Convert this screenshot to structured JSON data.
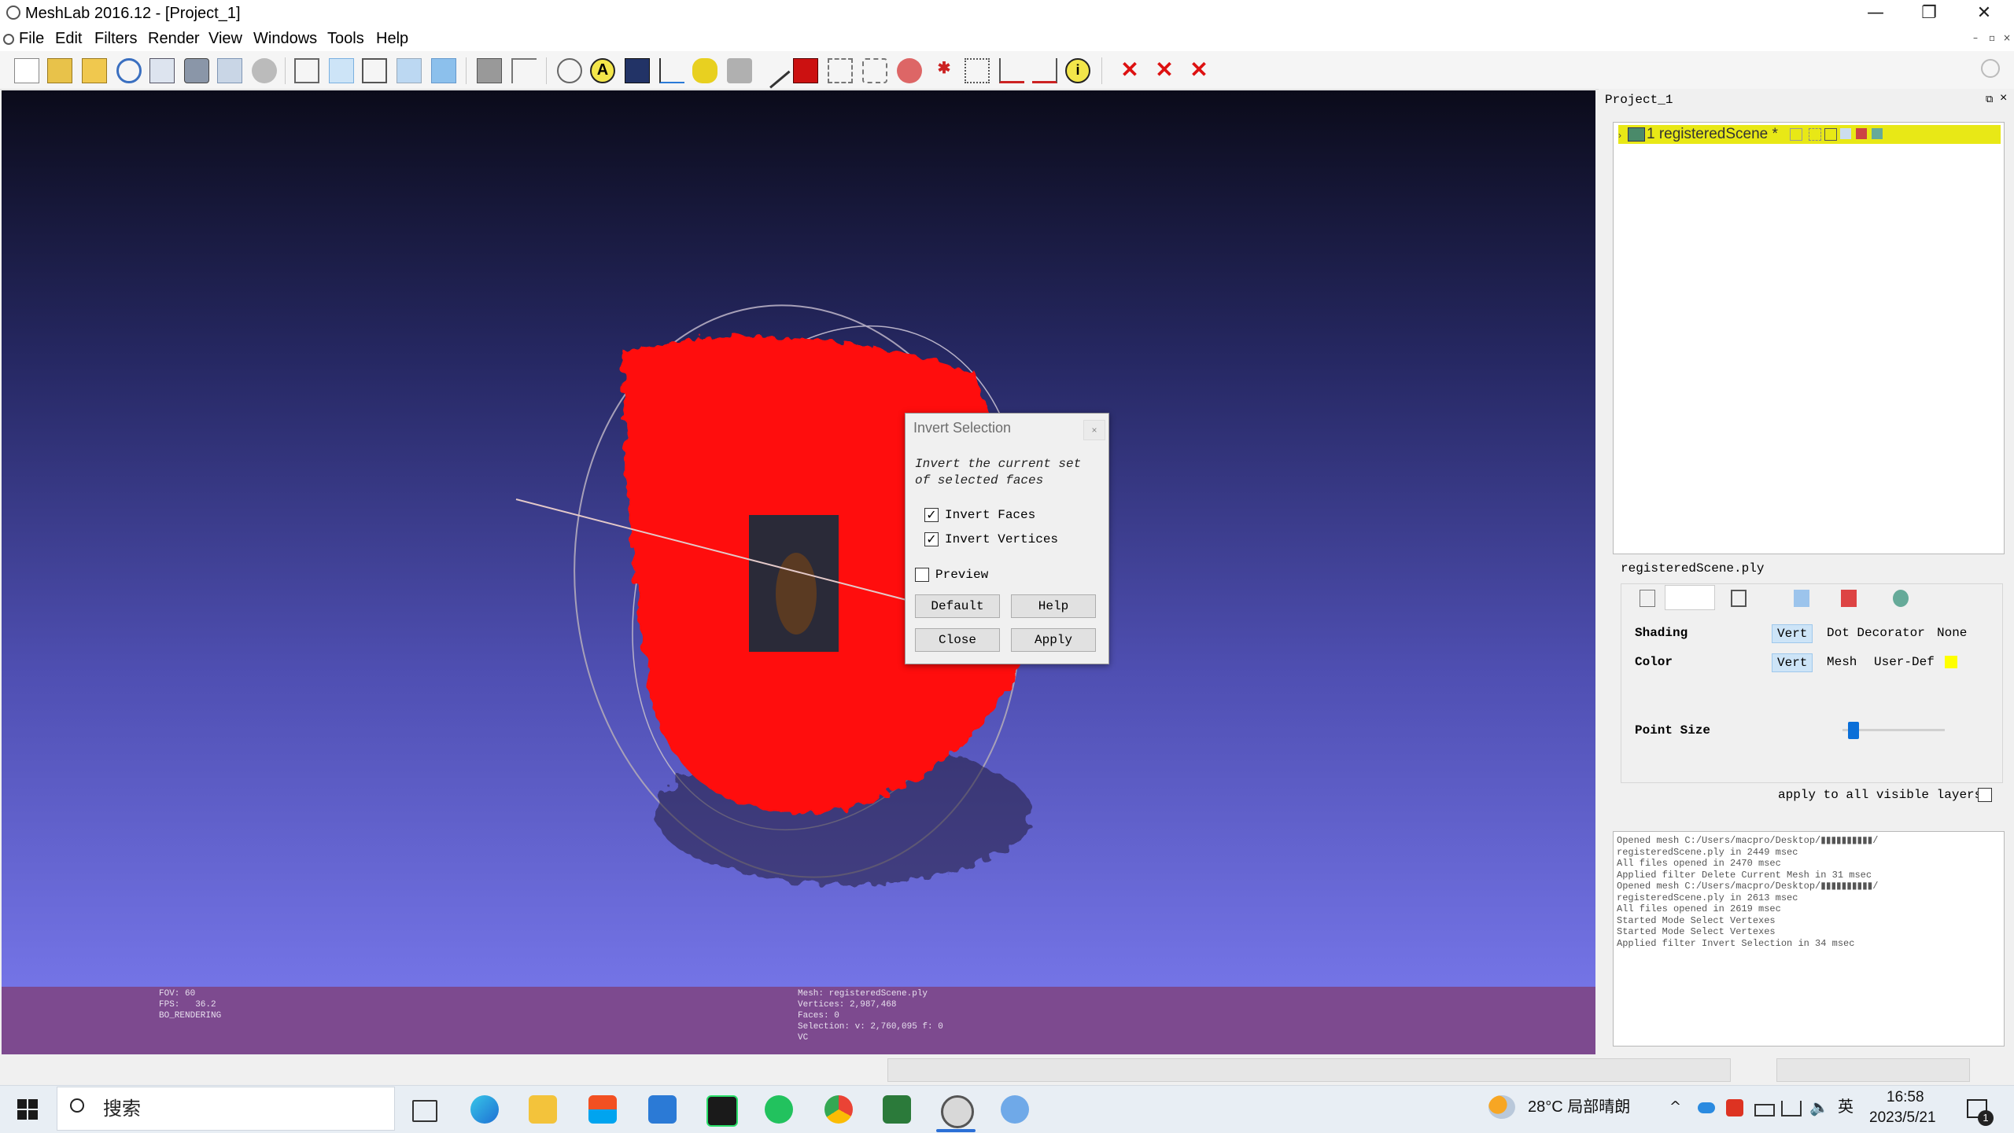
{
  "window": {
    "title": "MeshLab 2016.12 - [Project_1]",
    "controls": {
      "minimize": "—",
      "restore": "❐",
      "close": "✕"
    }
  },
  "menubar": {
    "items": [
      "File",
      "Edit",
      "Filters",
      "Render",
      "View",
      "Windows",
      "Tools",
      "Help"
    ],
    "mdi_controls": [
      "–",
      "▫",
      "×"
    ]
  },
  "viewport": {
    "info_left": [
      "FOV: 60",
      "FPS:   36.2",
      "BO_RENDERING"
    ],
    "info_center": [
      "Mesh: registeredScene.ply",
      "Vertices: 2,987,468",
      "Faces: 0",
      "Selection: v: 2,760,095 f: 0",
      "VC"
    ],
    "colors": {
      "points": "#ff1010",
      "infobar": "#7d4a8f"
    }
  },
  "dialog": {
    "title": "Invert Selection",
    "close": "×",
    "description": "Invert the current set of selected faces",
    "options": [
      {
        "label": "Invert Faces",
        "checked": true
      },
      {
        "label": "Invert Vertices",
        "checked": true
      },
      {
        "label": "Preview",
        "checked": false
      }
    ],
    "buttons": {
      "default": "Default",
      "help": "Help",
      "close": "Close",
      "apply": "Apply"
    }
  },
  "layers_panel": {
    "title": "Project_1",
    "layer": {
      "index_name": "1 registeredScene *",
      "highlight": "#e8e816"
    }
  },
  "props_panel": {
    "filename": "registeredScene.ply",
    "shading": {
      "label": "Shading",
      "options": [
        "Vert",
        "Dot Decorator",
        "None"
      ],
      "selected": "Vert"
    },
    "color": {
      "label": "Color",
      "options": [
        "Vert",
        "Mesh",
        "User-Def"
      ],
      "selected": "Vert",
      "user_color": "#ffff00"
    },
    "point_size": {
      "label": "Point Size",
      "value_fraction": 0.05
    },
    "apply_all": {
      "label": "apply to all visible layers",
      "checked": false
    }
  },
  "log": [
    "Opened mesh C:/Users/macpro/Desktop/▮▮▮▮▮▮▮▮▮▮/",
    "registeredScene.ply in 2449 msec",
    "All files opened in 2470 msec",
    "Applied filter Delete Current Mesh in 31 msec",
    "Opened mesh C:/Users/macpro/Desktop/▮▮▮▮▮▮▮▮▮▮/",
    "registeredScene.ply in 2613 msec",
    "All files opened in 2619 msec",
    "Started Mode Select Vertexes",
    "Started Mode Select Vertexes",
    "Applied filter Invert Selection in 34 msec"
  ],
  "taskbar": {
    "search_placeholder": "搜索",
    "weather": "28°C 局部晴朗",
    "ime": "英",
    "time": "16:58",
    "date": "2023/5/21",
    "notification_count": "1"
  }
}
